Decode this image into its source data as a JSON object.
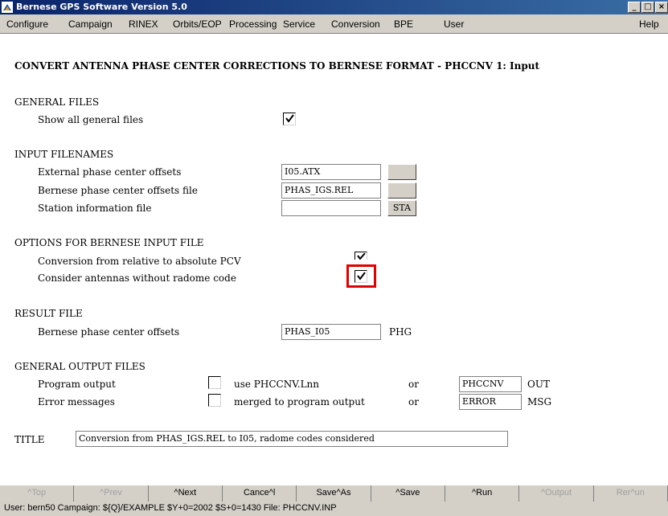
{
  "window": {
    "title": "Bernese GPS Software Version 5.0",
    "controls": [
      "_",
      "□",
      "×"
    ]
  },
  "menu": {
    "items": [
      "Configure",
      "Campaign",
      "RINEX",
      "Orbits/EOP",
      "Processing",
      "Service",
      "Conversion",
      "BPE",
      "User"
    ],
    "help": "Help"
  },
  "panel": {
    "heading": "CONVERT ANTENNA PHASE CENTER CORRECTIONS TO BERNESE FORMAT - PHCCNV 1: Input",
    "general_files": {
      "section": "GENERAL FILES",
      "show_all_label": "Show all general files",
      "show_all_checked": true
    },
    "input_filenames": {
      "section": "INPUT FILENAMES",
      "external_label": "External phase center offsets",
      "external_value": "I05.ATX",
      "external_btn": "",
      "bernese_label": "Bernese phase center offsets file",
      "bernese_value": "PHAS_IGS.REL",
      "bernese_btn": "",
      "station_label": "Station information file",
      "station_value": "",
      "station_btn": "STA"
    },
    "options": {
      "section": "OPTIONS FOR BERNESE INPUT FILE",
      "relative_label": "Conversion from relative to absolute PCV",
      "relative_checked": true,
      "radome_label": "Consider antennas without radome code",
      "radome_checked": true
    },
    "result_file": {
      "section": "RESULT FILE",
      "offsets_label": "Bernese phase center offsets",
      "offsets_value": "PHAS_I05",
      "offsets_ext": "PHG"
    },
    "output_files": {
      "section": "GENERAL OUTPUT FILES",
      "program_label": "Program output",
      "program_option": "use PHCCNV.Lnn",
      "program_or": "or",
      "program_value": "PHCCNV",
      "program_ext": "OUT",
      "error_label": "Error messages",
      "error_option": "merged to program output",
      "error_or": "or",
      "error_value": "ERROR",
      "error_ext": "MSG"
    },
    "title": {
      "label": "TITLE",
      "value": "Conversion from PHAS_IGS.REL to I05, radome codes considered"
    }
  },
  "buttons": [
    {
      "label": "^Top",
      "enabled": false
    },
    {
      "label": "^Prev",
      "enabled": false
    },
    {
      "label": "^Next",
      "enabled": true
    },
    {
      "label": "Cance^l",
      "enabled": true
    },
    {
      "label": "Save^As",
      "enabled": true
    },
    {
      "label": "^Save",
      "enabled": true
    },
    {
      "label": "^Run",
      "enabled": true
    },
    {
      "label": "^Output",
      "enabled": false
    },
    {
      "label": "Rer^un",
      "enabled": false
    }
  ],
  "status": {
    "text": "User: bern50  Campaign: ${Q}/EXAMPLE  $Y+0=2002  $S+0=1430  File: PHCCNV.INP"
  },
  "colors": {
    "titlebar": "#0a246a",
    "highlight": "#e00000",
    "chrome": "#d4d0c8"
  }
}
